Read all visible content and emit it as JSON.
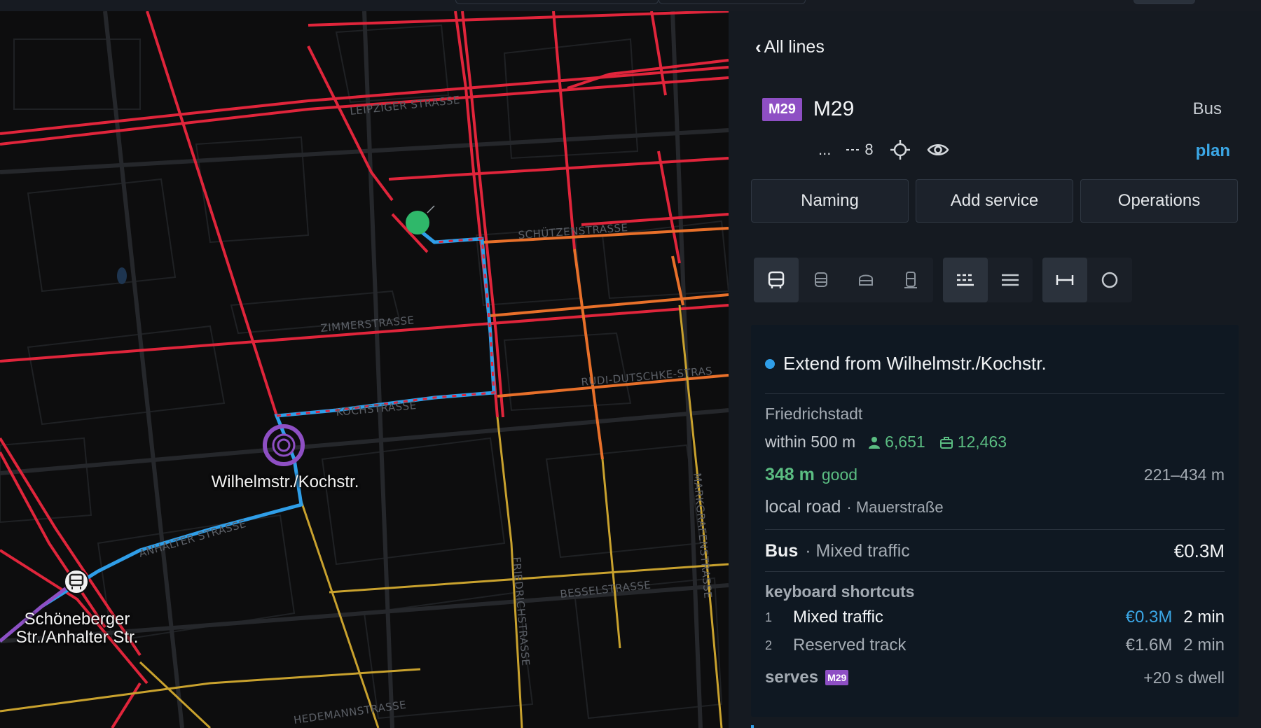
{
  "map": {
    "street_labels": [
      "LEIPZIGER STRASSE",
      "SCHÜTZENSTRASSE",
      "ZIMMERSTRASSE",
      "KOCHSTRASSE",
      "RUDI-DUTSCHKE-STRAS",
      "ANHALTER STRASSE",
      "BESSELSTRASSE",
      "HEDEMANNSTRASSE",
      "MARKGRAFENSTRASSE",
      "FRIEDRICHSTRASSE"
    ],
    "stops": {
      "selected": "Wilhelmstr./Kochstr.",
      "other_line1": "Schöneberger",
      "other_line2": "Str./Anhalter Str."
    },
    "colors": {
      "red": "#e0253b",
      "orange": "#e8702a",
      "yellow": "#c9a22e",
      "route_blue": "#2f9ee8",
      "line_purple": "#8e4fc4",
      "marker_green": "#2fb86a"
    }
  },
  "panel": {
    "back_label": "All lines",
    "line": {
      "badge": "M29",
      "name": "M29",
      "mode": "Bus",
      "ellipsis": "...",
      "stop_count": "8",
      "plan_link": "plan"
    },
    "buttons": [
      "Naming",
      "Add service",
      "Operations"
    ],
    "tools": {
      "vehicle_icons": [
        "bus-icon",
        "tram-icon",
        "ferry-icon",
        "train-icon"
      ],
      "list_icons": [
        "dashed-lines-icon",
        "solid-lines-icon"
      ],
      "shape_icons": [
        "segment-icon",
        "circle-icon"
      ]
    },
    "card": {
      "title": "Extend from Wilhelmstr./Kochstr.",
      "area": "Friedrichstadt",
      "within_label": "within 500 m",
      "residents": "6,651",
      "jobs": "12,463",
      "distance": "348 m",
      "distance_quality": "good",
      "distance_range": "221–434 m",
      "road_type": "local road",
      "road_name": "· Mauerstraße",
      "mode": "Bus",
      "mode_detail": "· Mixed traffic",
      "mode_cost": "€0.3M",
      "shortcuts_title": "keyboard shortcuts",
      "options": [
        {
          "key": "1",
          "label": "Mixed traffic",
          "cost": "€0.3M",
          "time": "2 min"
        },
        {
          "key": "2",
          "label": "Reserved track",
          "cost": "€1.6M",
          "time": "2 min"
        }
      ],
      "serves_label": "serves",
      "serves_badge": "M29",
      "dwell": "+20 s dwell"
    }
  }
}
